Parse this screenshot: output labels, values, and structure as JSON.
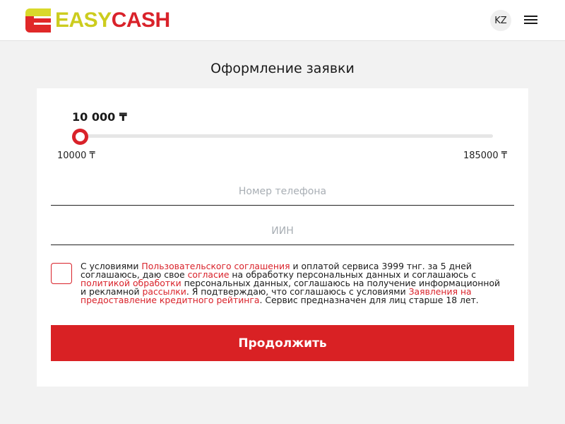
{
  "header": {
    "logo_easy": "EASY",
    "logo_cash": "CASH",
    "lang_label": "KZ"
  },
  "page": {
    "title": "Оформление заявки"
  },
  "slider": {
    "amount": "10 000 ₸",
    "min_label": "10000 ₸",
    "max_label": "185000 ₸",
    "value": 10000,
    "min": 10000,
    "max": 185000
  },
  "form": {
    "phone_placeholder": "Номер телефона",
    "phone_value": "",
    "iin_placeholder": "ИИН",
    "iin_value": "",
    "consent_checked": false,
    "consent": {
      "t1": "С условиями ",
      "l1": "Пользовательского соглашения",
      "t2": " и оплатой сервиса 3999 тнг. за 5 дней соглашаюсь, даю свое ",
      "l2": "согласие",
      "t3": " на обработку персональных данных и соглашаюсь с ",
      "l3": "политикой обработки",
      "t4": " персональных данных, соглашаюсь на получение информационной и рекламной ",
      "l4": "рассылки",
      "t5": ". Я подтверждаю, что соглашаюсь с условиями ",
      "l5": "Заявления на предоставление кредитного рейтинга",
      "t6": ". Сервис предназначен для лиц старше 18 лет."
    },
    "submit_label": "Продолжить"
  },
  "colors": {
    "accent": "#d9222a",
    "logo_yellow": "#cccc1e",
    "background": "#f2f2f2"
  }
}
